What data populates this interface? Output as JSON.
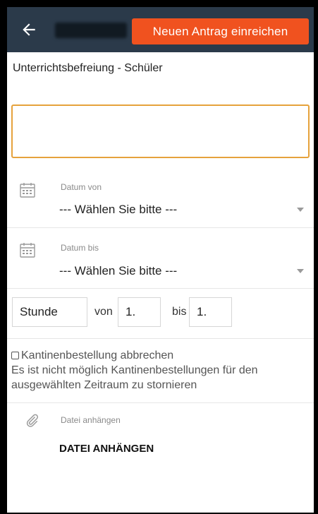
{
  "header": {
    "back_icon": "arrow-left-icon",
    "submit_label": "Neuen Antrag einreichen",
    "background": "#2b3a4a",
    "accent": "#f0521f"
  },
  "form": {
    "type_title": "Unterrichtsbefreiung - Schüler",
    "reason_value": "",
    "date_from": {
      "label": "Datum von",
      "value": "--- Wählen Sie bitte ---",
      "icon": "calendar-icon"
    },
    "date_to": {
      "label": "Datum bis",
      "value": "--- Wählen Sie bitte ---",
      "icon": "calendar-icon"
    },
    "lesson": {
      "unit": "Stunde",
      "from_label": "von",
      "from_value": "1.",
      "to_label": "bis",
      "to_value": "1."
    },
    "canteen": {
      "checked": false,
      "label": "Kantinenbestellung abbrechen",
      "notice": "Es ist nicht möglich Kantinenbestellungen für den ausgewählten Zeitraum zu stornieren"
    },
    "attachment": {
      "label": "Datei anhängen",
      "button": "DATEI ANHÄNGEN",
      "icon": "paperclip-icon"
    }
  }
}
